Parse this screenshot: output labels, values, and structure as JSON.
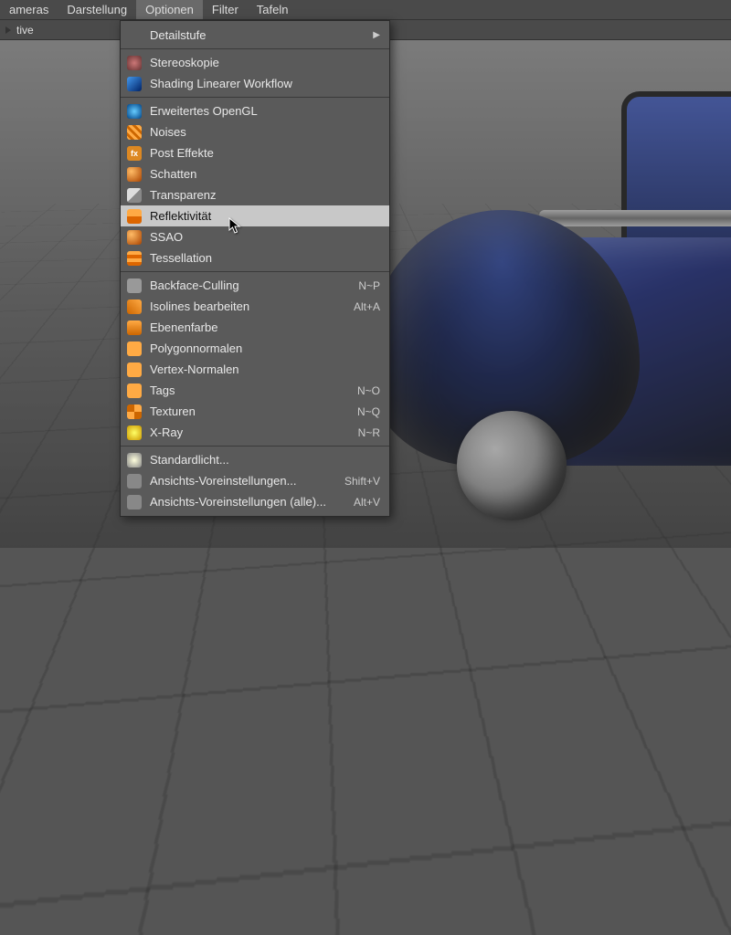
{
  "menubar": {
    "items": [
      {
        "label": "ameras"
      },
      {
        "label": "Darstellung"
      },
      {
        "label": "Optionen",
        "open": true
      },
      {
        "label": "Filter"
      },
      {
        "label": "Tafeln"
      }
    ]
  },
  "subbar": {
    "label": "tive"
  },
  "dropdown": {
    "groups": [
      [
        {
          "label": "Detailstufe",
          "icon": "",
          "submenu": true
        }
      ],
      [
        {
          "label": "Stereoskopie",
          "icon": "i-stereo"
        },
        {
          "label": "Shading Linearer Workflow",
          "icon": "i-lwf"
        }
      ],
      [
        {
          "label": "Erweitertes OpenGL",
          "icon": "i-ogl"
        },
        {
          "label": "Noises",
          "icon": "i-noise"
        },
        {
          "label": "Post Effekte",
          "icon": "i-fx",
          "iconText": "fx"
        },
        {
          "label": "Schatten",
          "icon": "i-shadow"
        },
        {
          "label": "Transparenz",
          "icon": "i-trans"
        },
        {
          "label": "Reflektivität",
          "icon": "i-refl",
          "highlight": true
        },
        {
          "label": "SSAO",
          "icon": "i-ssao"
        },
        {
          "label": "Tessellation",
          "icon": "i-tess"
        }
      ],
      [
        {
          "label": "Backface-Culling",
          "icon": "i-back",
          "shortcut": "N~P"
        },
        {
          "label": "Isolines bearbeiten",
          "icon": "i-iso",
          "shortcut": "Alt+A"
        },
        {
          "label": "Ebenenfarbe",
          "icon": "i-layer"
        },
        {
          "label": "Polygonnormalen",
          "icon": "i-pnorm"
        },
        {
          "label": "Vertex-Normalen",
          "icon": "i-vnorm"
        },
        {
          "label": "Tags",
          "icon": "i-tags",
          "shortcut": "N~O"
        },
        {
          "label": "Texturen",
          "icon": "i-tex",
          "shortcut": "N~Q"
        },
        {
          "label": "X-Ray",
          "icon": "i-xray",
          "shortcut": "N~R"
        }
      ],
      [
        {
          "label": "Standardlicht...",
          "icon": "i-light"
        },
        {
          "label": "Ansichts-Voreinstellungen...",
          "icon": "i-pref",
          "shortcut": "Shift+V"
        },
        {
          "label": "Ansichts-Voreinstellungen (alle)...",
          "icon": "i-pref",
          "shortcut": "Alt+V"
        }
      ]
    ]
  }
}
